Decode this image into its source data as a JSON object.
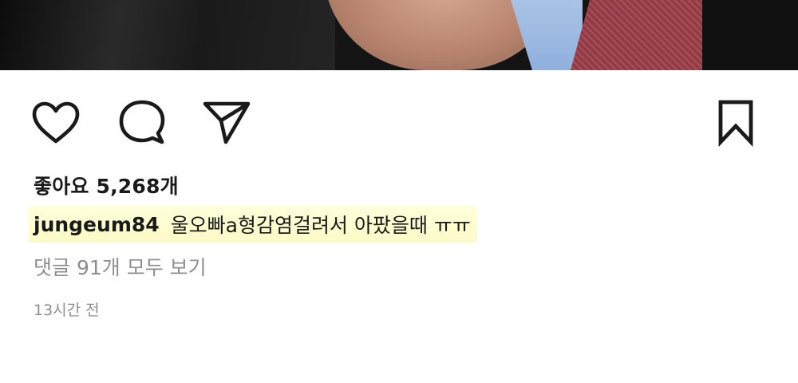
{
  "post": {
    "likes_text": "좋아요 5,268개",
    "caption": {
      "username": "jungeum84",
      "text": "울오빠a형감염걸려서 아팠을때 ㅠㅠ"
    },
    "view_comments_text": "댓글 91개 모두 보기",
    "timestamp": "13시간 전"
  },
  "icons": {
    "like": "heart-icon",
    "comment": "comment-icon",
    "share": "send-icon",
    "save": "bookmark-icon"
  },
  "colors": {
    "text_primary": "#1a1a1a",
    "text_secondary": "#8e8e8e",
    "caption_highlight": "#fcfac4"
  }
}
